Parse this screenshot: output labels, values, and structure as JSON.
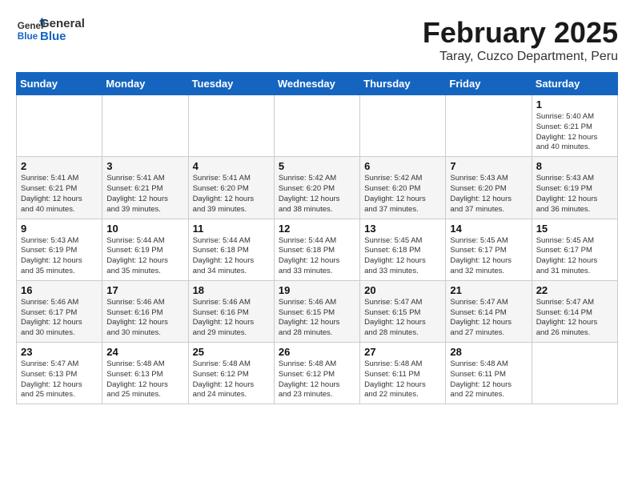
{
  "logo": {
    "general": "General",
    "blue": "Blue"
  },
  "header": {
    "month": "February 2025",
    "location": "Taray, Cuzco Department, Peru"
  },
  "weekdays": [
    "Sunday",
    "Monday",
    "Tuesday",
    "Wednesday",
    "Thursday",
    "Friday",
    "Saturday"
  ],
  "weeks": [
    [
      {
        "day": "",
        "info": ""
      },
      {
        "day": "",
        "info": ""
      },
      {
        "day": "",
        "info": ""
      },
      {
        "day": "",
        "info": ""
      },
      {
        "day": "",
        "info": ""
      },
      {
        "day": "",
        "info": ""
      },
      {
        "day": "1",
        "info": "Sunrise: 5:40 AM\nSunset: 6:21 PM\nDaylight: 12 hours\nand 40 minutes."
      }
    ],
    [
      {
        "day": "2",
        "info": "Sunrise: 5:41 AM\nSunset: 6:21 PM\nDaylight: 12 hours\nand 40 minutes."
      },
      {
        "day": "3",
        "info": "Sunrise: 5:41 AM\nSunset: 6:21 PM\nDaylight: 12 hours\nand 39 minutes."
      },
      {
        "day": "4",
        "info": "Sunrise: 5:41 AM\nSunset: 6:20 PM\nDaylight: 12 hours\nand 39 minutes."
      },
      {
        "day": "5",
        "info": "Sunrise: 5:42 AM\nSunset: 6:20 PM\nDaylight: 12 hours\nand 38 minutes."
      },
      {
        "day": "6",
        "info": "Sunrise: 5:42 AM\nSunset: 6:20 PM\nDaylight: 12 hours\nand 37 minutes."
      },
      {
        "day": "7",
        "info": "Sunrise: 5:43 AM\nSunset: 6:20 PM\nDaylight: 12 hours\nand 37 minutes."
      },
      {
        "day": "8",
        "info": "Sunrise: 5:43 AM\nSunset: 6:19 PM\nDaylight: 12 hours\nand 36 minutes."
      }
    ],
    [
      {
        "day": "9",
        "info": "Sunrise: 5:43 AM\nSunset: 6:19 PM\nDaylight: 12 hours\nand 35 minutes."
      },
      {
        "day": "10",
        "info": "Sunrise: 5:44 AM\nSunset: 6:19 PM\nDaylight: 12 hours\nand 35 minutes."
      },
      {
        "day": "11",
        "info": "Sunrise: 5:44 AM\nSunset: 6:18 PM\nDaylight: 12 hours\nand 34 minutes."
      },
      {
        "day": "12",
        "info": "Sunrise: 5:44 AM\nSunset: 6:18 PM\nDaylight: 12 hours\nand 33 minutes."
      },
      {
        "day": "13",
        "info": "Sunrise: 5:45 AM\nSunset: 6:18 PM\nDaylight: 12 hours\nand 33 minutes."
      },
      {
        "day": "14",
        "info": "Sunrise: 5:45 AM\nSunset: 6:17 PM\nDaylight: 12 hours\nand 32 minutes."
      },
      {
        "day": "15",
        "info": "Sunrise: 5:45 AM\nSunset: 6:17 PM\nDaylight: 12 hours\nand 31 minutes."
      }
    ],
    [
      {
        "day": "16",
        "info": "Sunrise: 5:46 AM\nSunset: 6:17 PM\nDaylight: 12 hours\nand 30 minutes."
      },
      {
        "day": "17",
        "info": "Sunrise: 5:46 AM\nSunset: 6:16 PM\nDaylight: 12 hours\nand 30 minutes."
      },
      {
        "day": "18",
        "info": "Sunrise: 5:46 AM\nSunset: 6:16 PM\nDaylight: 12 hours\nand 29 minutes."
      },
      {
        "day": "19",
        "info": "Sunrise: 5:46 AM\nSunset: 6:15 PM\nDaylight: 12 hours\nand 28 minutes."
      },
      {
        "day": "20",
        "info": "Sunrise: 5:47 AM\nSunset: 6:15 PM\nDaylight: 12 hours\nand 28 minutes."
      },
      {
        "day": "21",
        "info": "Sunrise: 5:47 AM\nSunset: 6:14 PM\nDaylight: 12 hours\nand 27 minutes."
      },
      {
        "day": "22",
        "info": "Sunrise: 5:47 AM\nSunset: 6:14 PM\nDaylight: 12 hours\nand 26 minutes."
      }
    ],
    [
      {
        "day": "23",
        "info": "Sunrise: 5:47 AM\nSunset: 6:13 PM\nDaylight: 12 hours\nand 25 minutes."
      },
      {
        "day": "24",
        "info": "Sunrise: 5:48 AM\nSunset: 6:13 PM\nDaylight: 12 hours\nand 25 minutes."
      },
      {
        "day": "25",
        "info": "Sunrise: 5:48 AM\nSunset: 6:12 PM\nDaylight: 12 hours\nand 24 minutes."
      },
      {
        "day": "26",
        "info": "Sunrise: 5:48 AM\nSunset: 6:12 PM\nDaylight: 12 hours\nand 23 minutes."
      },
      {
        "day": "27",
        "info": "Sunrise: 5:48 AM\nSunset: 6:11 PM\nDaylight: 12 hours\nand 22 minutes."
      },
      {
        "day": "28",
        "info": "Sunrise: 5:48 AM\nSunset: 6:11 PM\nDaylight: 12 hours\nand 22 minutes."
      },
      {
        "day": "",
        "info": ""
      }
    ]
  ]
}
